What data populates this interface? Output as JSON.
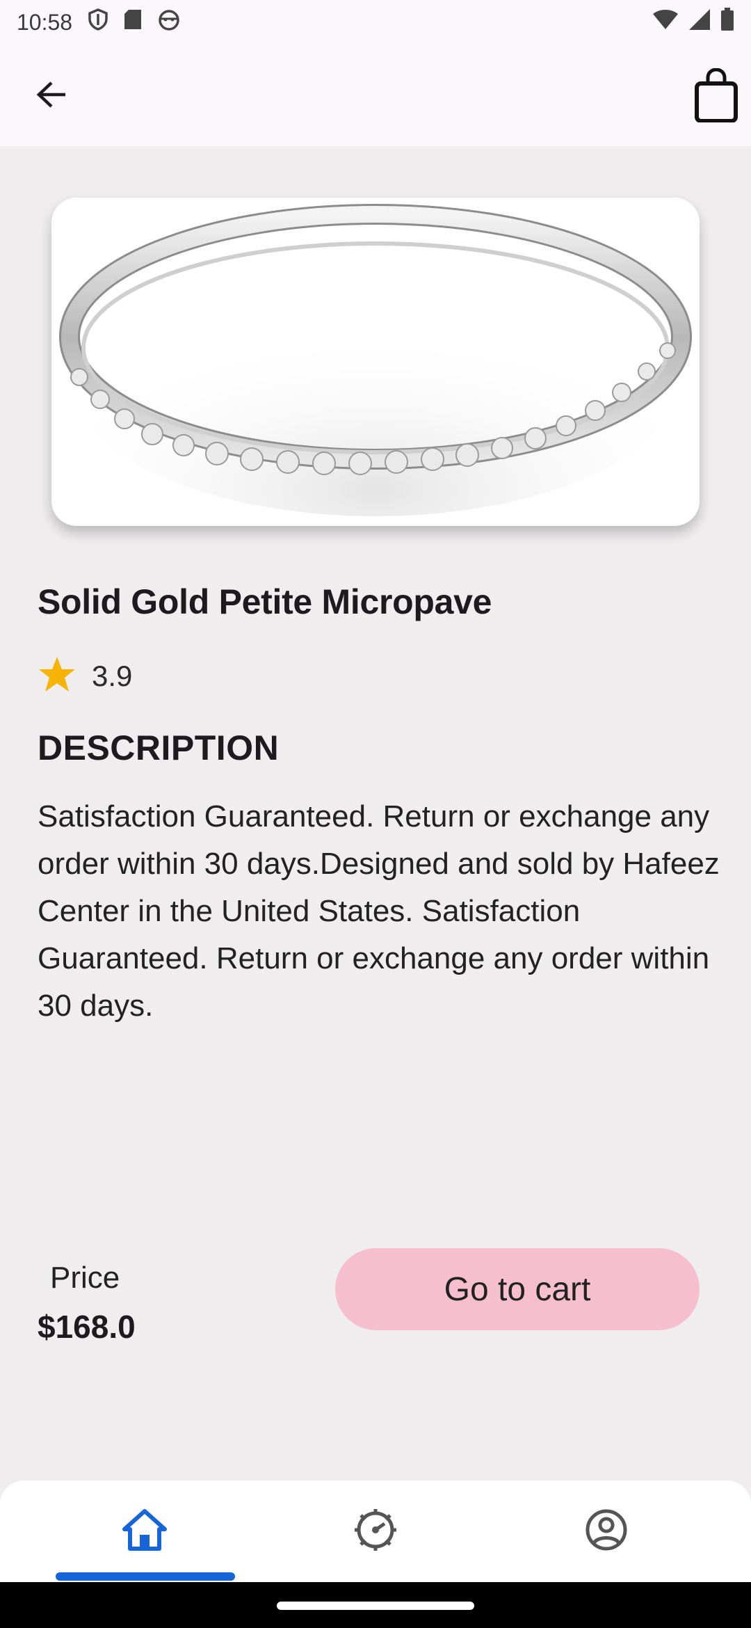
{
  "status_bar": {
    "time": "10:58",
    "left_icons": [
      "shield-icon",
      "sd-card-icon",
      "android-icon"
    ],
    "right_icons": [
      "wifi-icon",
      "signal-icon",
      "battery-icon"
    ]
  },
  "app_bar": {
    "back_icon": "arrow-back-icon",
    "cart_icon": "shopping-bag-icon"
  },
  "product": {
    "image_alt": "silver micropave ring",
    "title": "Solid Gold Petite Micropave",
    "rating": "3.9",
    "rating_icon": "star-icon",
    "description_heading": "DESCRIPTION",
    "description": "Satisfaction Guaranteed. Return or exchange any order within 30 days.Designed and sold by Hafeez Center in the United States. Satisfaction Guaranteed. Return or exchange any order within 30 days.",
    "price_label": "Price",
    "price": "$168.0",
    "cart_button": "Go to cart"
  },
  "bottom_nav": {
    "items": [
      {
        "icon": "home-icon",
        "active": true
      },
      {
        "icon": "dashboard-icon",
        "active": false
      },
      {
        "icon": "account-icon",
        "active": false
      }
    ]
  },
  "colors": {
    "accent": "#1565d8",
    "cart_button": "#f5bfd0",
    "star": "#f6b400",
    "background": "#efedee"
  }
}
